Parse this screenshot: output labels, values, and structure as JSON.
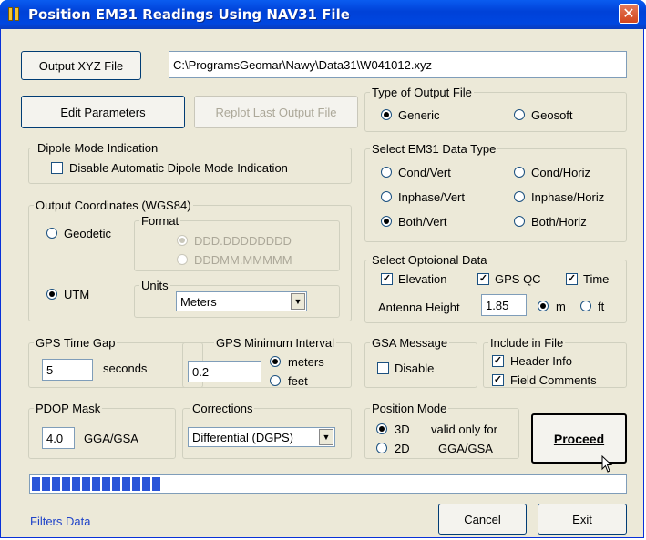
{
  "window": {
    "title": "Position EM31 Readings Using NAV31 File",
    "close_glyph": "✕"
  },
  "output_xyz": {
    "button_label": "Output XYZ File",
    "path_value": "C:\\ProgramsGeomar\\Nawy\\Data31\\W041012.xyz"
  },
  "buttons": {
    "edit_parameters": "Edit Parameters",
    "replot": "Replot Last Output File",
    "proceed": "Proceed",
    "cancel": "Cancel",
    "exit": "Exit"
  },
  "type_of_output": {
    "title": "Type of Output File",
    "generic": "Generic",
    "geosoft": "Geosoft",
    "selected": "generic"
  },
  "dipole": {
    "title": "Dipole Mode Indication",
    "checkbox_label": "Disable Automatic Dipole Mode Indication",
    "checked": false
  },
  "em31_type": {
    "title": "Select EM31 Data Type",
    "options": [
      "Cond/Vert",
      "Cond/Horiz",
      "Inphase/Vert",
      "Inphase/Horiz",
      "Both/Vert",
      "Both/Horiz"
    ],
    "selected": "Both/Vert"
  },
  "coords": {
    "title": "Output Coordinates (WGS84)",
    "geodetic": "Geodetic",
    "utm": "UTM",
    "selected": "utm",
    "format_title": "Format",
    "format_options": [
      "DDD.DDDDDDDD",
      "DDDMM.MMMMM"
    ],
    "format_selected": "DDD.DDDDDDDD",
    "units_title": "Units",
    "units_value": "Meters"
  },
  "optional": {
    "title": "Select Optoional Data",
    "elevation": "Elevation",
    "gps_qc": "GPS QC",
    "time": "Time",
    "antenna_label": "Antenna Height",
    "antenna_value": "1.85",
    "m": "m",
    "ft": "ft",
    "unit_selected": "m"
  },
  "gps_time_gap": {
    "title": "GPS Time Gap",
    "value": "5",
    "unit": "seconds"
  },
  "gps_min_interval": {
    "title": "GPS Minimum Interval",
    "value": "0.2",
    "meters": "meters",
    "feet": "feet",
    "selected": "meters"
  },
  "gsa": {
    "title": "GSA Message",
    "disable": "Disable",
    "checked": false
  },
  "include": {
    "title": "Include in File",
    "header": "Header Info",
    "comments": "Field Comments"
  },
  "pdop": {
    "title": "PDOP Mask",
    "value": "4.0",
    "unit": "GGA/GSA"
  },
  "corrections": {
    "title": "Corrections",
    "value": "Differential (DGPS)"
  },
  "position_mode": {
    "title": "Position Mode",
    "opt_3d": "3D",
    "opt_2d": "2D",
    "note1": "valid only for",
    "note2": "GGA/GSA",
    "selected": "3D"
  },
  "progress": {
    "filled_blocks": 13,
    "total_blocks": 66,
    "fraction": 0.2
  },
  "status_text": "Filters Data",
  "glyphs": {
    "check": "✓",
    "dropdown": "▼"
  }
}
